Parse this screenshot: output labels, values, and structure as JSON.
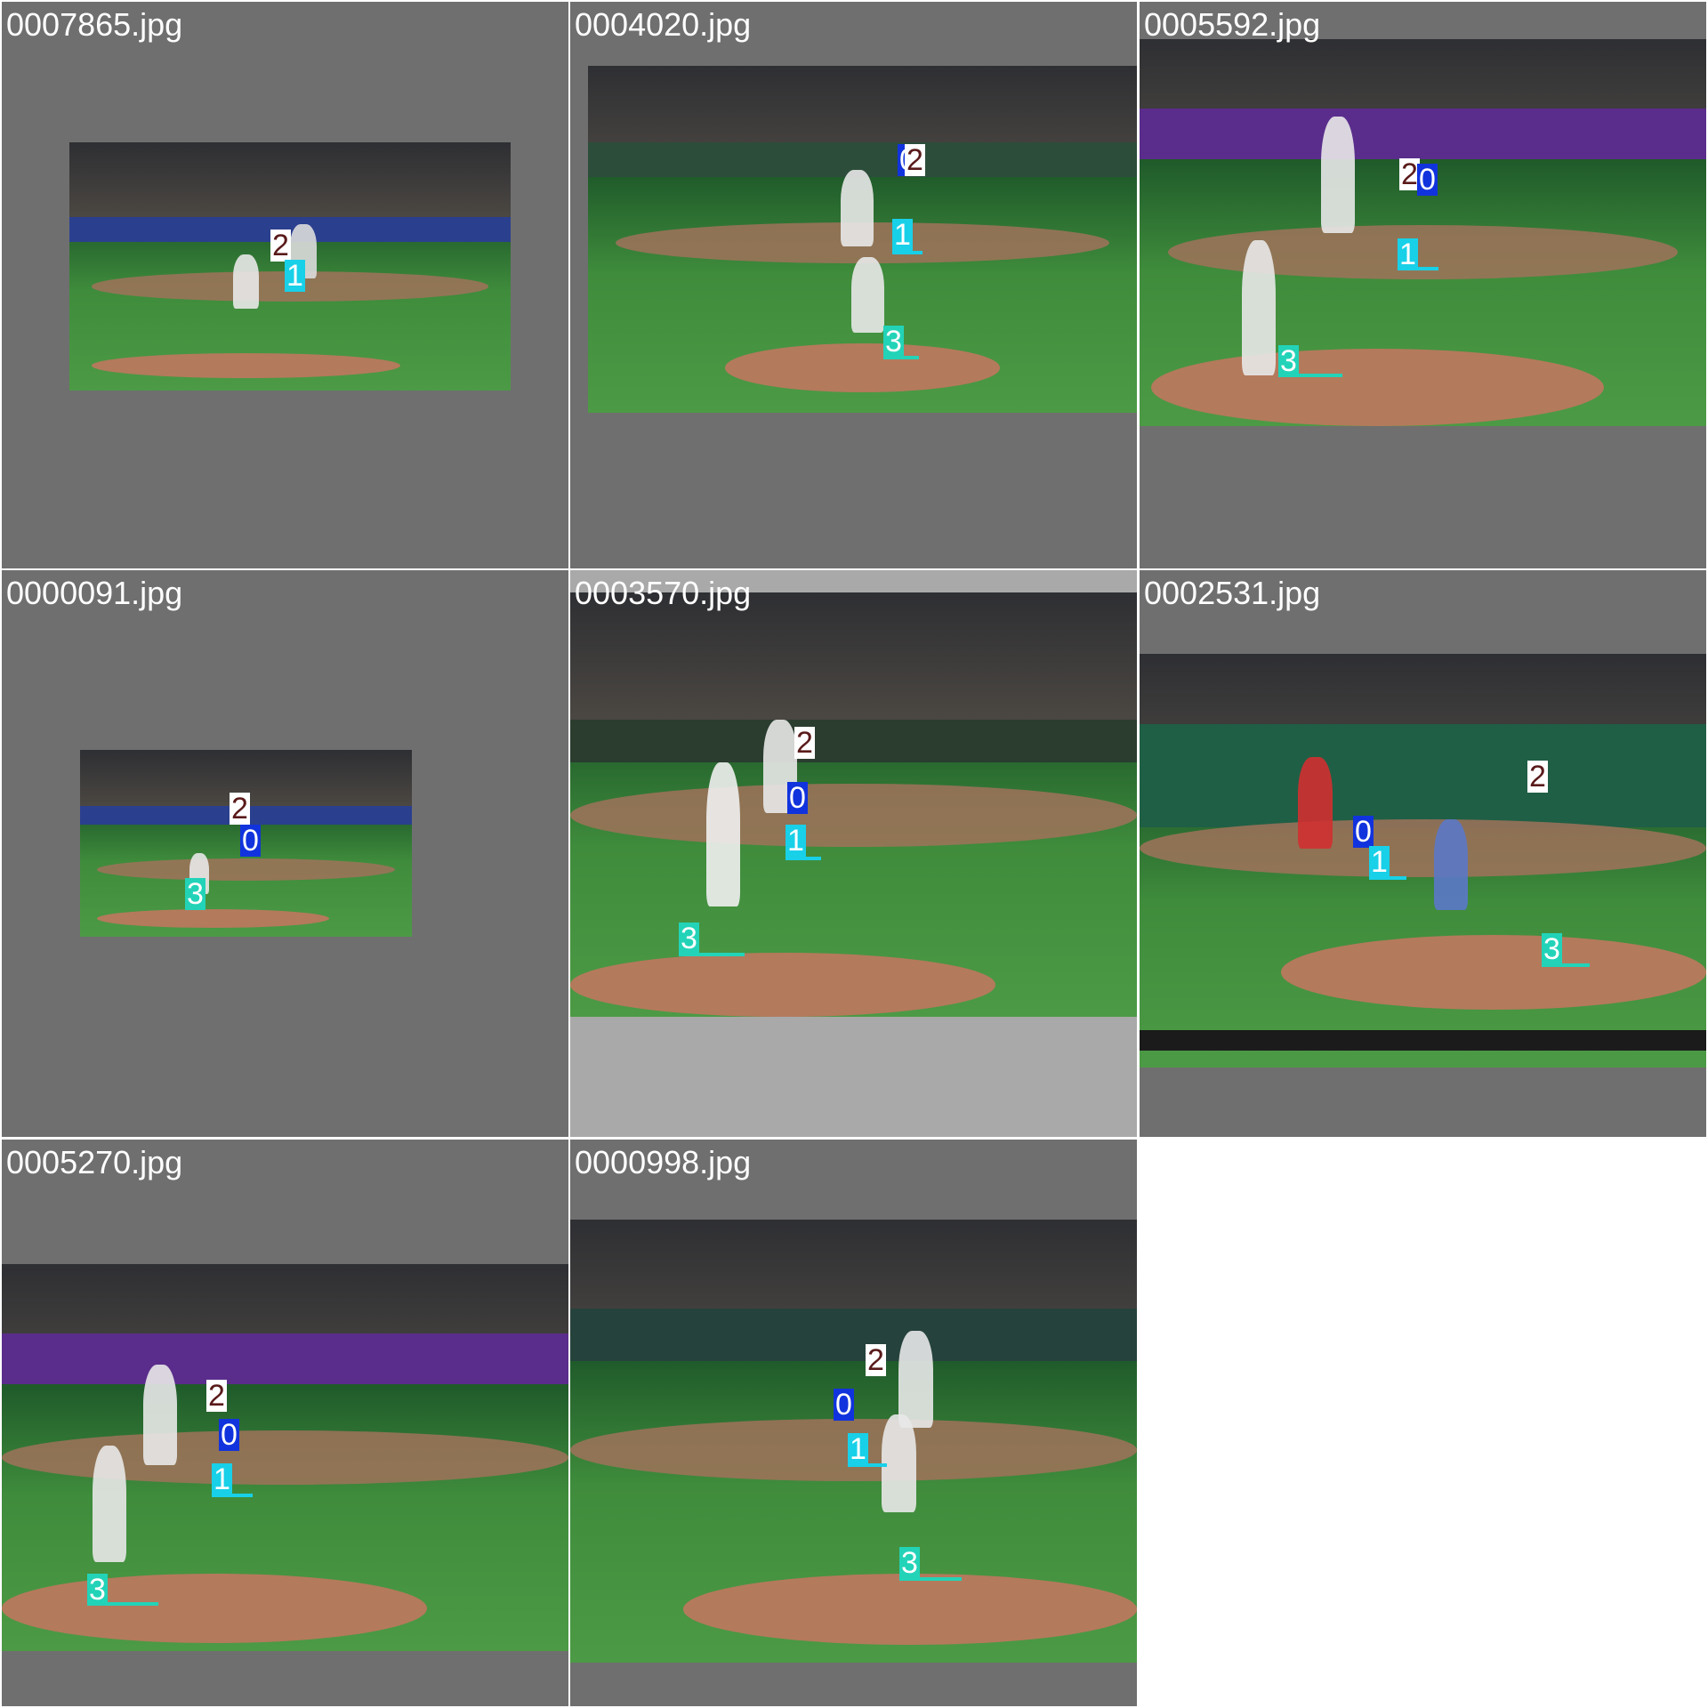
{
  "tiles": [
    {
      "file": "0007865.jpg"
    },
    {
      "file": "0004020.jpg"
    },
    {
      "file": "0005592.jpg"
    },
    {
      "file": "0000091.jpg"
    },
    {
      "file": "0003570.jpg"
    },
    {
      "file": "0002531.jpg"
    },
    {
      "file": "0005270.jpg"
    },
    {
      "file": "0000998.jpg"
    }
  ],
  "labels": {
    "c0": "0",
    "c1": "1",
    "c2": "2",
    "c3": "3"
  },
  "colors": {
    "tile_bg": "#6f6f6f",
    "class0": "#1133dd",
    "class1": "#18d0e8",
    "class2": "#ffffff",
    "class3": "#22d3b8"
  }
}
